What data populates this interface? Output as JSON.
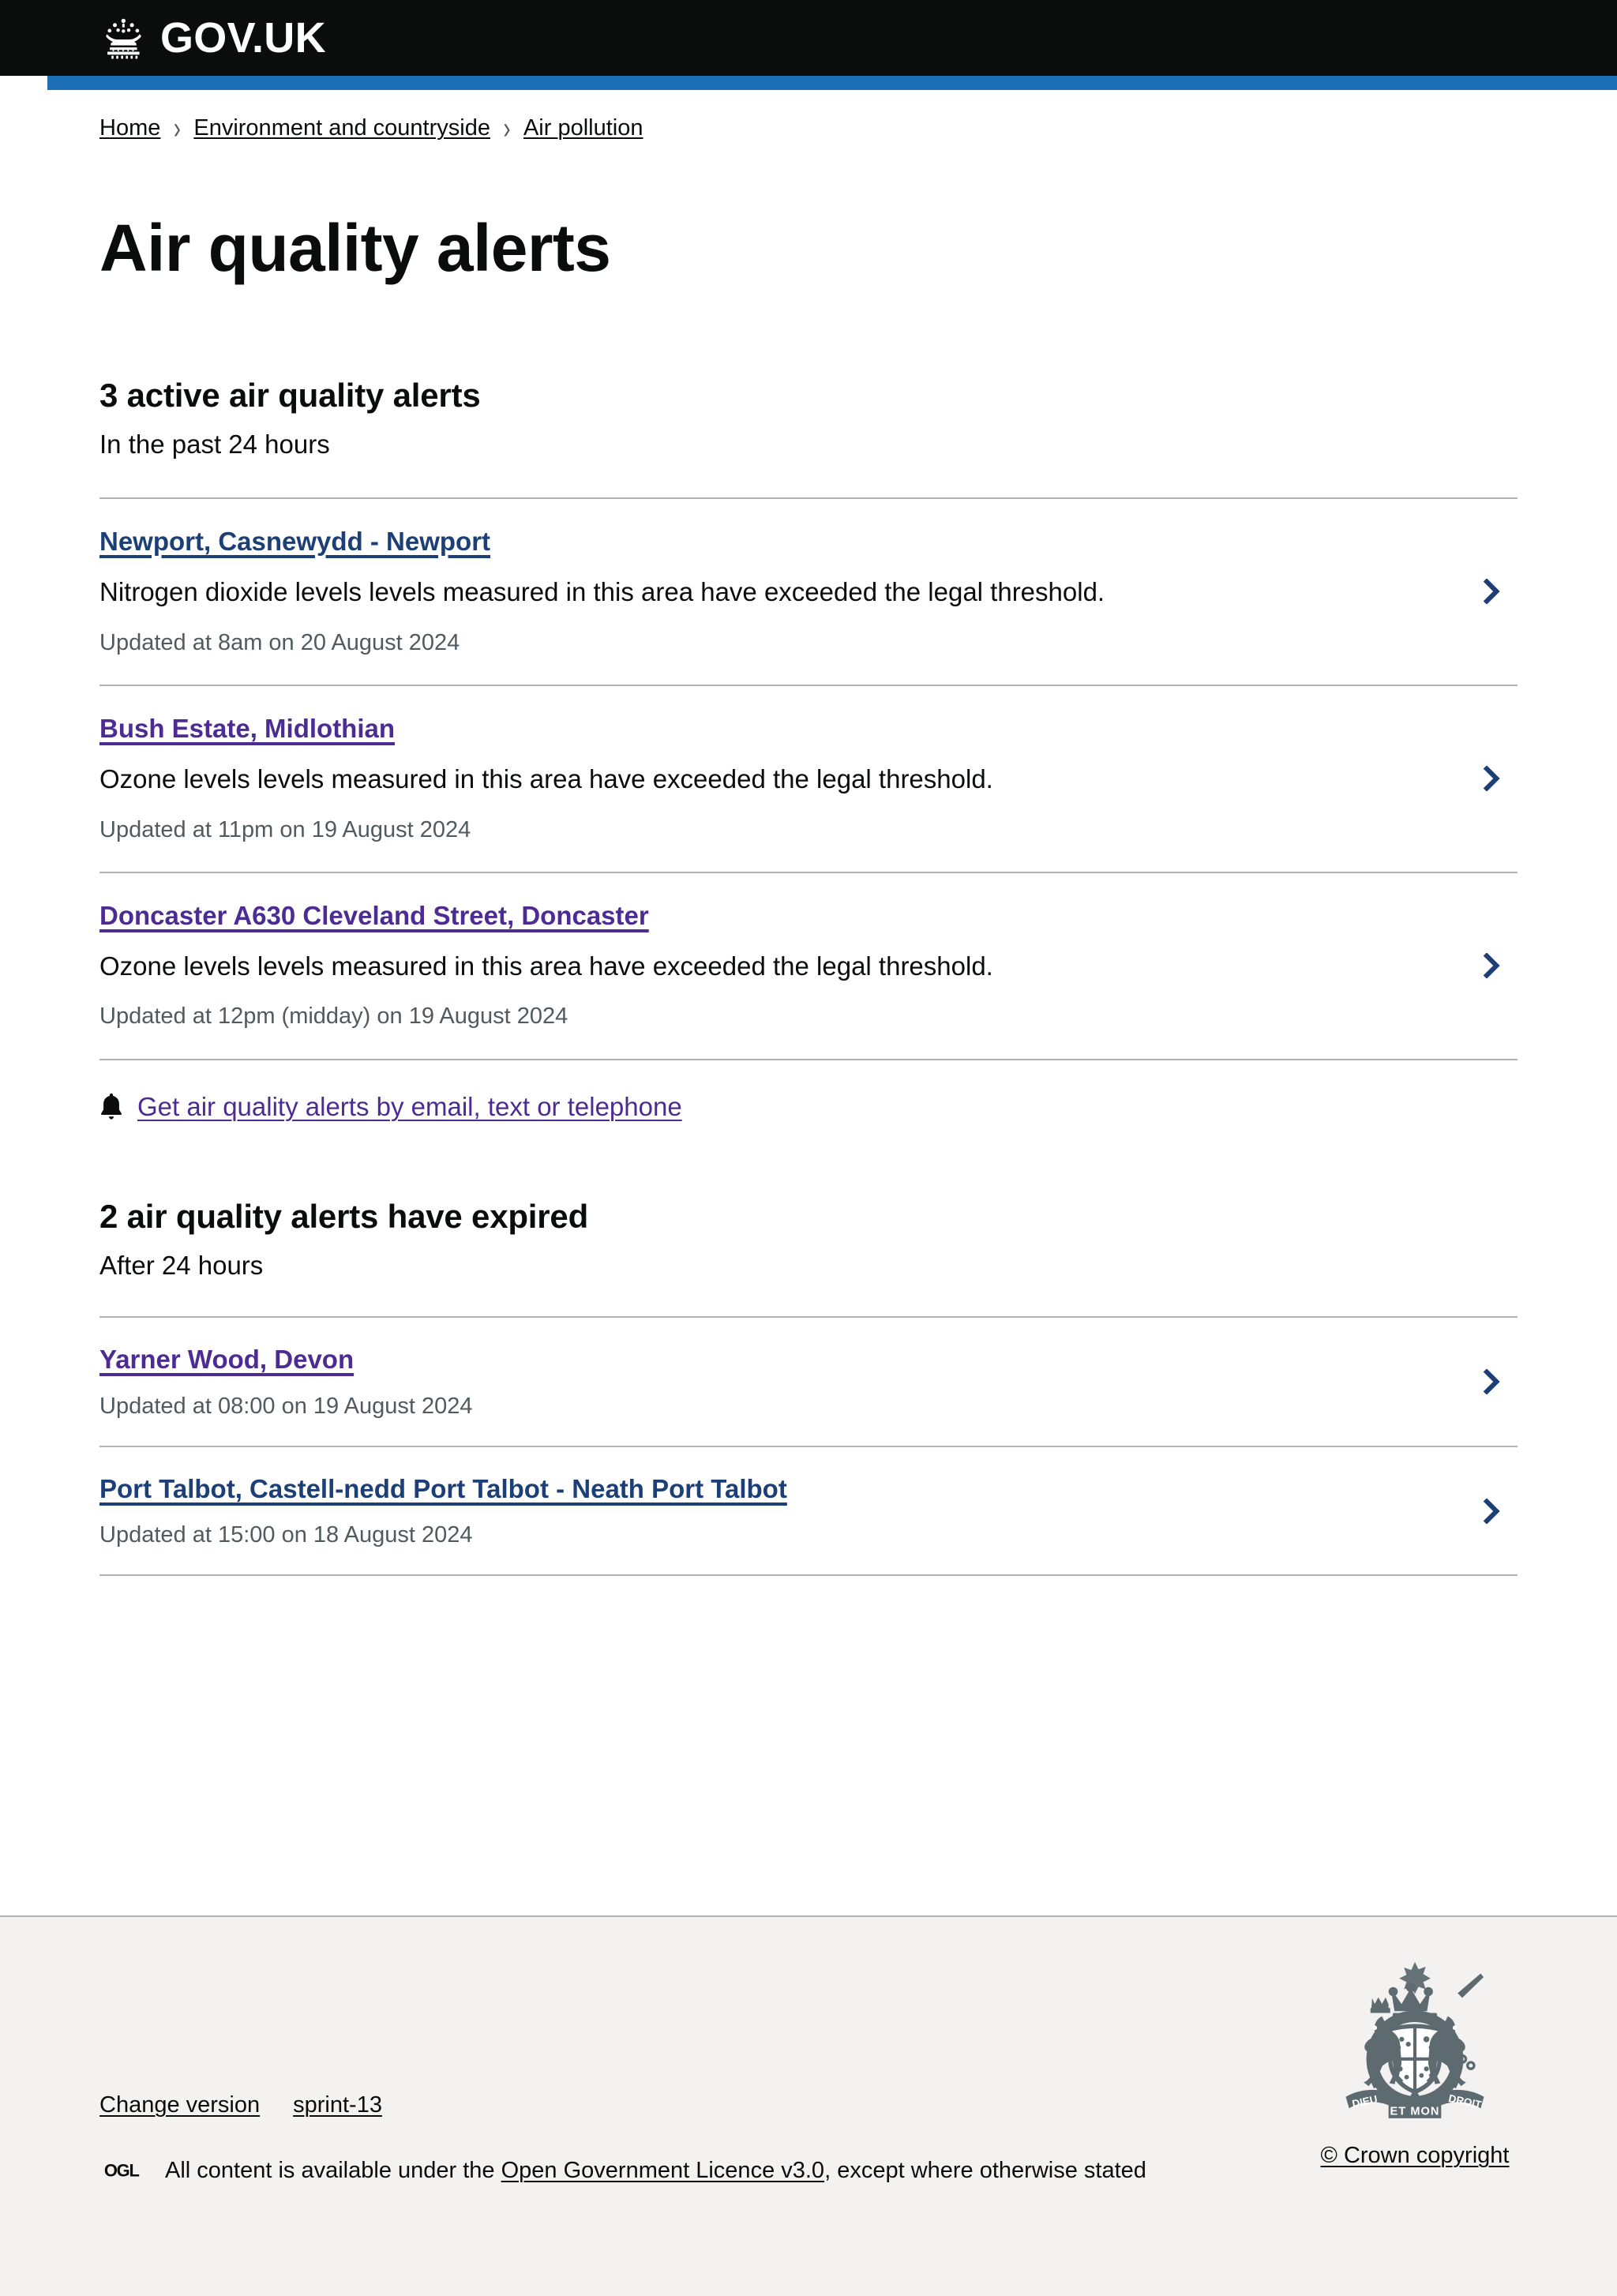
{
  "header": {
    "logo_text": "GOV.UK",
    "crown_icon": "crown-icon",
    "accent_color": "#1d70b8",
    "background_color": "#0b0c0c"
  },
  "breadcrumb": {
    "separator": "›",
    "items": [
      {
        "label": "Home"
      },
      {
        "label": "Environment and countryside"
      },
      {
        "label": "Air pollution"
      }
    ]
  },
  "page": {
    "title": "Air quality alerts"
  },
  "active_section": {
    "heading": "3 active air quality alerts",
    "subheading": "In the past 24 hours",
    "alerts": [
      {
        "location": "Newport, Casnewydd - Newport",
        "description": "Nitrogen dioxide levels levels measured in this area have exceeded the legal threshold.",
        "updated": "Updated at 8am on 20 August 2024",
        "link_state": "unvisited",
        "link_color": "#1d3f77",
        "chevron_icon": "chevron-right-icon"
      },
      {
        "location": "Bush Estate, Midlothian",
        "description": "Ozone levels levels measured in this area have exceeded the legal threshold.",
        "updated": "Updated at 11pm on 19 August 2024",
        "link_state": "visited",
        "link_color": "#4c2c92",
        "chevron_icon": "chevron-right-icon"
      },
      {
        "location": "Doncaster A630 Cleveland Street, Doncaster",
        "description": "Ozone levels levels measured in this area have exceeded the legal threshold.",
        "updated": "Updated at 12pm (midday) on 19 August 2024",
        "link_state": "visited",
        "link_color": "#4c2c92",
        "chevron_icon": "chevron-right-icon"
      }
    ]
  },
  "subscribe": {
    "icon": "bell-icon",
    "label": "Get air quality alerts by email, text or telephone"
  },
  "expired_section": {
    "heading": "2 air quality alerts have expired",
    "subheading": "After 24 hours",
    "alerts": [
      {
        "location": "Yarner Wood, Devon",
        "updated": "Updated at 08:00 on 19 August 2024",
        "link_state": "visited",
        "link_color": "#4c2c92",
        "chevron_icon": "chevron-right-icon"
      },
      {
        "location": "Port Talbot, Castell-nedd Port Talbot - Neath Port Talbot",
        "updated": "Updated at 15:00 on 18 August 2024",
        "link_state": "unvisited",
        "link_color": "#1d3f77",
        "chevron_icon": "chevron-right-icon"
      }
    ]
  },
  "footer": {
    "background_color": "#f3f2f1",
    "change_version_label": "Change version",
    "sprint_label": "sprint-13",
    "ogl_logo_text": "OGL",
    "licence_prefix": "All content is available under the",
    "licence_link": "Open Government Licence v3.0",
    "licence_suffix": ", except where otherwise stated",
    "crown_copyright": "© Crown copyright",
    "royal_arms_icon": "royal-coat-of-arms-icon"
  }
}
